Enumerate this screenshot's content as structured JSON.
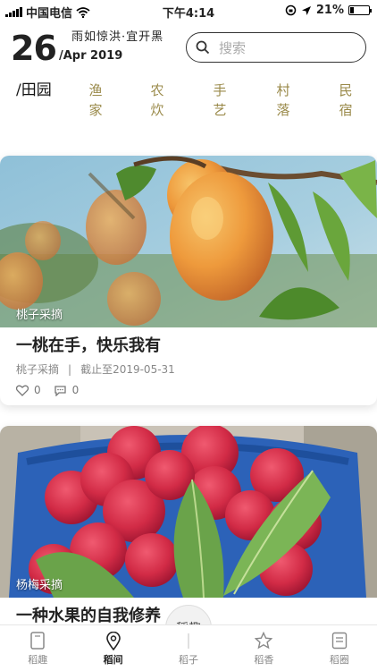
{
  "status_bar": {
    "carrier": "中国电信",
    "time": "下午4:14",
    "battery_percent": "21%",
    "battery_level": 0.21
  },
  "header": {
    "day": "26",
    "motto": "雨如惊洪·宜开黑",
    "month_year": "/Apr 2019",
    "search_placeholder": "搜索"
  },
  "tabs": [
    {
      "label": "/田园",
      "active": true
    },
    {
      "label": "渔家"
    },
    {
      "label": "农炊"
    },
    {
      "label": "手艺"
    },
    {
      "label": "村落"
    },
    {
      "label": "民宿"
    }
  ],
  "cards": [
    {
      "tag": "桃子采摘",
      "title": "一桃在手，快乐我有",
      "category": "桃子采摘",
      "separator": "|",
      "deadline": "截止至2019-05-31",
      "likes": "0",
      "comments": "0"
    },
    {
      "tag": "杨梅采摘",
      "title": "一种水果的自我修养"
    }
  ],
  "center_logo_text": "稻趣",
  "nav": [
    {
      "label": "稻趣",
      "icon": "phone-icon"
    },
    {
      "label": "稻间",
      "icon": "location-pin-icon",
      "active": true
    },
    {
      "label": "稻子",
      "icon": "grain-icon"
    },
    {
      "label": "稻香",
      "icon": "star-icon"
    },
    {
      "label": "稻圈",
      "icon": "document-icon"
    }
  ],
  "colors": {
    "tab_inactive": "#9a8a4a",
    "nav_active": "#222222",
    "nav_inactive": "#888888"
  }
}
